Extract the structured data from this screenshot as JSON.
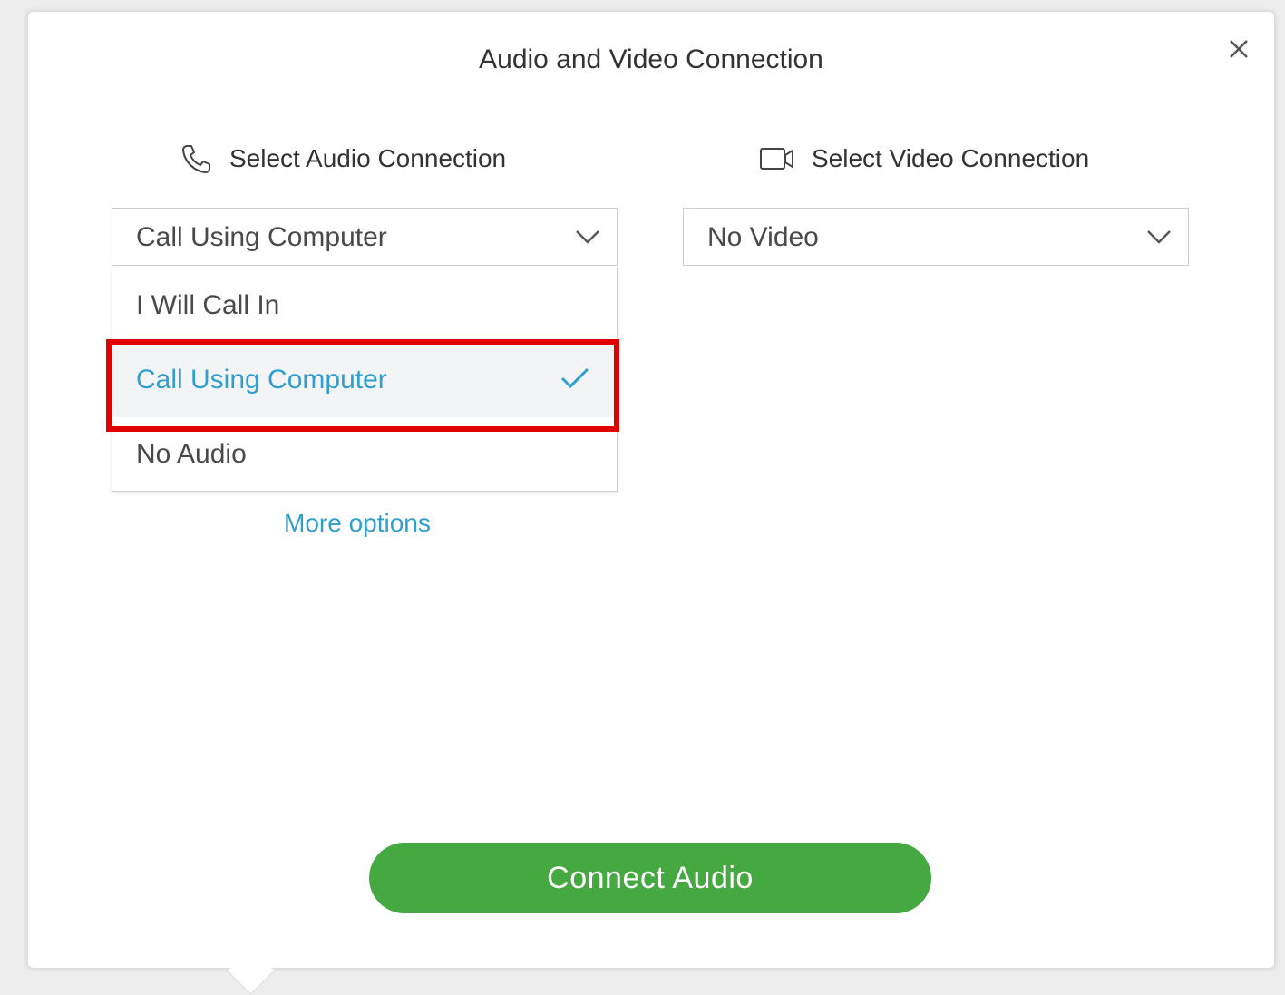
{
  "dialog": {
    "title": "Audio and Video Connection"
  },
  "audio": {
    "heading": "Select Audio Connection",
    "selected_value": "Call Using Computer",
    "options": [
      {
        "label": "I Will Call In",
        "selected": false
      },
      {
        "label": "Call Using Computer",
        "selected": true
      },
      {
        "label": "No Audio",
        "selected": false
      }
    ],
    "more_options": "More options"
  },
  "video": {
    "heading": "Select Video Connection",
    "selected_value": "No Video"
  },
  "actions": {
    "connect_label": "Connect Audio"
  },
  "colors": {
    "accent_blue": "#2f9fd0",
    "connect_green": "#46a840",
    "highlight_red": "#e00000"
  },
  "icons": {
    "audio": "phone-icon",
    "video": "video-camera-icon",
    "close": "close-icon",
    "dropdown": "chevron-down-icon",
    "selected": "checkmark-icon"
  }
}
